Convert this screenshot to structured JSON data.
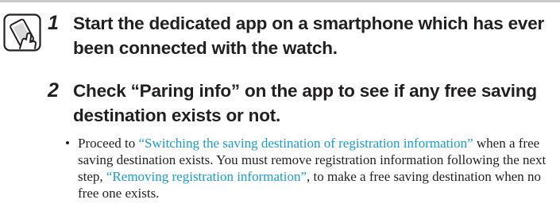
{
  "icon": "smartphone-hand-icon",
  "colors": {
    "text": "#231f20",
    "link": "#1a9ad6",
    "rule": "#c9c9c9"
  },
  "steps": [
    {
      "number": "1",
      "text": "Start the dedicated app on a smartphone which has ever been connected with the watch."
    },
    {
      "number": "2",
      "text": "Check “Paring info” on the app to see if any free saving destination exists or not."
    }
  ],
  "note": {
    "bullet": "•",
    "part1": "Proceed to ",
    "link1": "“Switching the saving destination of registration information”",
    "part2": " when a free saving destination exists. You must remove registration information following the next step, ",
    "link2": "“Removing registration information”",
    "part3": ", to make a free saving destination when no free one exists."
  }
}
